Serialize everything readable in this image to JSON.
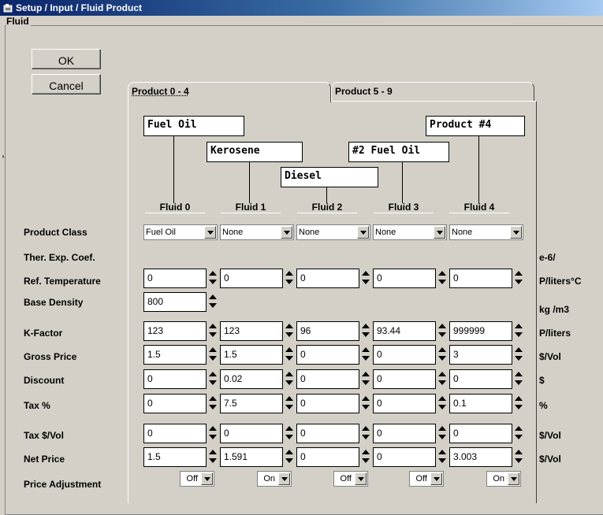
{
  "window": {
    "title": "Setup / Input / Fluid Product"
  },
  "group_label": "Fluid",
  "buttons": {
    "ok": "OK",
    "cancel": "Cancel"
  },
  "tabs": [
    {
      "label": "Product 0 - 4"
    },
    {
      "label": "Product 5 - 9"
    }
  ],
  "products": [
    {
      "name": "Fuel Oil",
      "fluid": "Fluid 0"
    },
    {
      "name": "Kerosene",
      "fluid": "Fluid 1"
    },
    {
      "name": "Diesel",
      "fluid": "Fluid 2"
    },
    {
      "name": "#2 Fuel Oil",
      "fluid": "Fluid 3"
    },
    {
      "name": "Product #4",
      "fluid": "Fluid 4"
    }
  ],
  "stray_mark": ",",
  "rows": {
    "product_class": {
      "label": "Product Class",
      "values": [
        "Fuel Oil",
        "None",
        "None",
        "None",
        "None"
      ]
    },
    "ther_exp_coef": {
      "label": "Ther. Exp. Coef.",
      "unit": "e-6/"
    },
    "ref_temperature": {
      "label": "Ref. Temperature",
      "unit": "P/liters°C",
      "values": [
        "0",
        "0",
        "0",
        "0",
        "0"
      ]
    },
    "base_density": {
      "label": "Base Density",
      "unit": "kg /m3",
      "values": [
        "800"
      ]
    },
    "k_factor": {
      "label": "K-Factor",
      "unit": "P/liters",
      "values": [
        "123",
        "123",
        "96",
        "93.44",
        "999999"
      ]
    },
    "gross_price": {
      "label": "Gross Price",
      "unit": "$/Vol",
      "values": [
        "1.5",
        "1.5",
        "0",
        "0",
        "3"
      ]
    },
    "discount": {
      "label": "Discount",
      "unit": "$",
      "values": [
        "0",
        "0.02",
        "0",
        "0",
        "0"
      ]
    },
    "tax_pct": {
      "label": "Tax %",
      "unit": "%",
      "values": [
        "0",
        "7.5",
        "0",
        "0",
        "0.1"
      ]
    },
    "tax_vol": {
      "label": "Tax  $/Vol",
      "unit": "$/Vol",
      "values": [
        "0",
        "0",
        "0",
        "0",
        "0"
      ]
    },
    "net_price": {
      "label": "Net Price",
      "unit": "$/Vol",
      "values": [
        "1.5",
        "1.591",
        "0",
        "0",
        "3.003"
      ]
    },
    "price_adjustment": {
      "label": "Price Adjustment",
      "values": [
        "Off",
        "On",
        "Off",
        "Off",
        "On"
      ]
    }
  },
  "icons": {
    "app": "window-app-icon",
    "dropdown": "chevron-down-icon",
    "spinner": "spin-updown-icon"
  },
  "colors": {
    "titlebar_start": "#0a246a",
    "titlebar_end": "#a6caf0",
    "face": "#d4d0c8"
  }
}
